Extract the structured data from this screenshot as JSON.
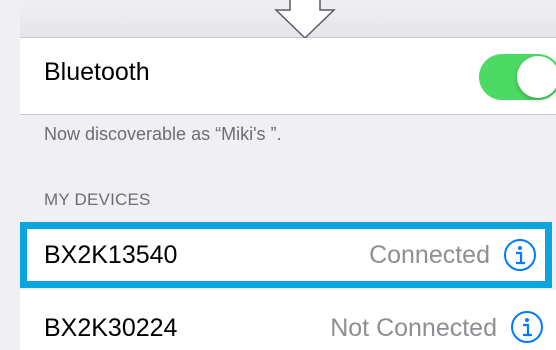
{
  "bluetooth": {
    "label": "Bluetooth",
    "enabled": true
  },
  "discoverable_note": "Now discoverable as “Miki's ”.",
  "my_devices": {
    "header": "MY DEVICES",
    "devices": [
      {
        "name": "BX2K13540",
        "status": "Connected",
        "highlighted": true
      },
      {
        "name": "BX2K30224",
        "status": "Not Connected",
        "highlighted": false
      }
    ]
  },
  "colors": {
    "toggle_on": "#4cd964",
    "accent": "#007aff",
    "highlight": "#0aa5dc"
  },
  "icons": [
    "arrow-down-icon",
    "info-icon"
  ]
}
